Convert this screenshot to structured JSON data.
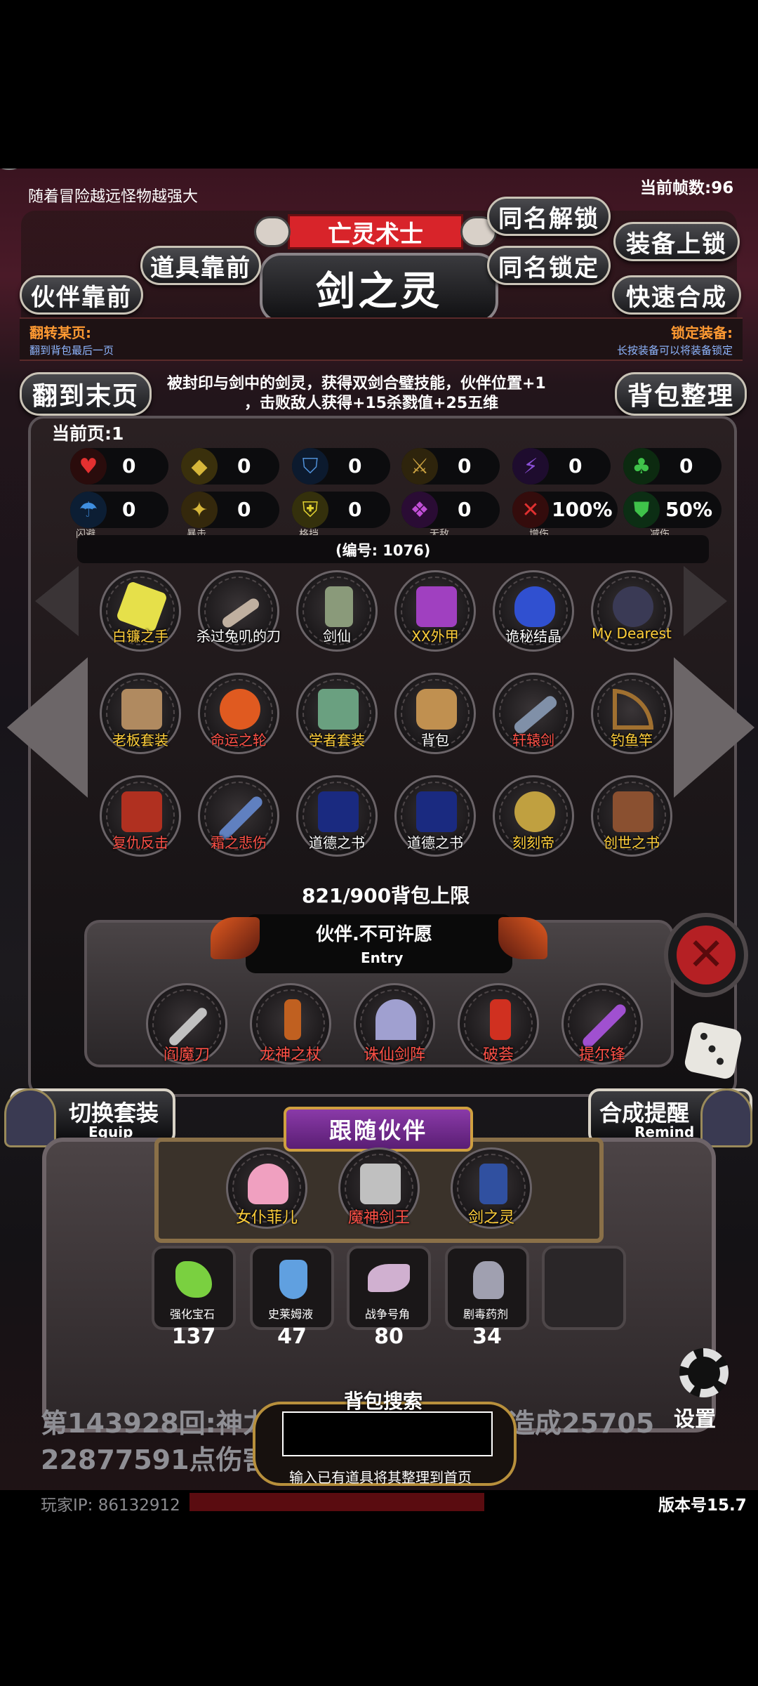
{
  "header": {
    "fps": "当前帧数:96",
    "tip": "随着冒险越远怪物越强大",
    "class_tag": "亡灵术士",
    "partner_name": "剑之灵"
  },
  "buttons": {
    "item_front": "道具靠前",
    "partner_front": "伙伴靠前",
    "same_unlock": "同名解锁",
    "same_lock": "同名锁定",
    "equip_lock": "装备上锁",
    "quick_merge": "快速合成",
    "last_page": "翻到末页",
    "bag_sort": "背包整理"
  },
  "info_bar": {
    "flip_label": "翻转某页:",
    "flip_sub": "翻到背包最后一页",
    "lock_label": "锁定装备:",
    "lock_sub": "长按装备可以将装备锁定"
  },
  "description": {
    "line1": "被封印与剑中的剑灵，获得双剑合璧技能，伙伴位置+1",
    "line2": "，击败敌人获得+15杀戮值+25五维"
  },
  "page_label": "当前页:1",
  "stats_row1": [
    {
      "icon": "heart-icon",
      "value": "0",
      "color": "#e33030"
    },
    {
      "icon": "armor-icon",
      "value": "0",
      "color": "#d6b63a"
    },
    {
      "icon": "helmet-icon",
      "value": "0",
      "color": "#4f8fd6"
    },
    {
      "icon": "sword-icon",
      "value": "0",
      "color": "#c8a040"
    },
    {
      "icon": "lightning-icon",
      "value": "0",
      "color": "#8a4fd6"
    },
    {
      "icon": "clover-icon",
      "value": "0",
      "color": "#3fc24a"
    }
  ],
  "stats_row2": [
    {
      "icon": "dodge-icon",
      "value": "0",
      "label": "闪避",
      "color": "#3f8fe0"
    },
    {
      "icon": "crit-icon",
      "value": "0",
      "label": "暴击",
      "color": "#d6b63a"
    },
    {
      "icon": "block-icon",
      "value": "0",
      "label": "格挡",
      "color": "#e0d030"
    },
    {
      "icon": "invincible-icon",
      "value": "0",
      "label": "无敌",
      "color": "#c04fd6"
    },
    {
      "icon": "damage-up-icon",
      "value": "100%",
      "label": "增伤",
      "color": "#e03030"
    },
    {
      "icon": "damage-reduce-icon",
      "value": "50%",
      "label": "减伤",
      "color": "#3fc24a"
    }
  ],
  "item_id": "(编号: 1076)",
  "grid_items": [
    {
      "label": "白镰之手",
      "color": "#e6e04a"
    },
    {
      "label": "杀过兔叽的刀",
      "color": "#c0b0a0"
    },
    {
      "label": "剑仙",
      "color": "#8a9a7a"
    },
    {
      "label": "XX外甲",
      "color": "#a040c0"
    },
    {
      "label": "诡秘结晶",
      "color": "#3050d0"
    },
    {
      "label": "My Dearest",
      "color": "#3a3a55"
    },
    {
      "label": "老板套装",
      "color": "#b08a60"
    },
    {
      "label": "命运之轮",
      "color": "#e05a20"
    },
    {
      "label": "学者套装",
      "color": "#6aa080"
    },
    {
      "label": "背包",
      "color": "#c09050"
    },
    {
      "label": "轩辕剑",
      "color": "#8090a8"
    },
    {
      "label": "钓鱼竿",
      "color": "#a07030"
    },
    {
      "label": "复仇反击",
      "color": "#b03020"
    },
    {
      "label": "霜之悲伤",
      "color": "#6080c0"
    },
    {
      "label": "道德之书",
      "color": "#1a2a80"
    },
    {
      "label": "道德之书",
      "color": "#1a2a80"
    },
    {
      "label": "刻刻帝",
      "color": "#c0a040"
    },
    {
      "label": "创世之书",
      "color": "#8a5030"
    }
  ],
  "bag_limit": "821/900背包上限",
  "entry_panel": {
    "title": "伙伴.不可许愿",
    "sub": "Entry",
    "items": [
      {
        "label": "阎魔刀",
        "color": "#c0c0c0"
      },
      {
        "label": "龙神之杖",
        "color": "#c06020"
      },
      {
        "label": "诛仙剑阵",
        "color": "#a0a0d0"
      },
      {
        "label": "破荟",
        "color": "#d03020"
      },
      {
        "label": "提尔锋",
        "color": "#a050d0"
      }
    ]
  },
  "equip_button": {
    "main": "切换套装",
    "sub": "Equip"
  },
  "remind_button": {
    "main": "合成提醒",
    "sub": "Remind"
  },
  "follow_title": "跟随伙伴",
  "followers": [
    {
      "label": "女仆菲儿",
      "color": "#f0a0c0"
    },
    {
      "label": "魔神剑王",
      "color": "#c0c0c0"
    },
    {
      "label": "剑之灵",
      "color": "#3050a0"
    }
  ],
  "consumables": [
    {
      "label": "强化宝石",
      "count": "137",
      "color": "#7ad040"
    },
    {
      "label": "史莱姆液",
      "count": "47",
      "color": "#60a0e0"
    },
    {
      "label": "战争号角",
      "count": "80",
      "color": "#d0b0d0"
    },
    {
      "label": "剧毒药剂",
      "count": "34",
      "color": "#a0a0b0"
    },
    {
      "label": "",
      "count": "",
      "color": ""
    }
  ],
  "log": {
    "line1_left": "第143928回:神力",
    "line1_right": "造成25705",
    "line2": "22877591点伤害",
    "line3": "。。。。。。。。。。。。。。。。。"
  },
  "search": {
    "title": "背包搜索",
    "hint": "输入已有道具将其整理到首页",
    "placeholder": ""
  },
  "settings_label": "设置",
  "footer": {
    "player_ip": "玩家IP: 86132912",
    "version": "版本号15.7"
  },
  "colors": {
    "gold": "#f2c24a",
    "red_tag": "#d8242a",
    "purple_banner": "#6b2b8a"
  }
}
